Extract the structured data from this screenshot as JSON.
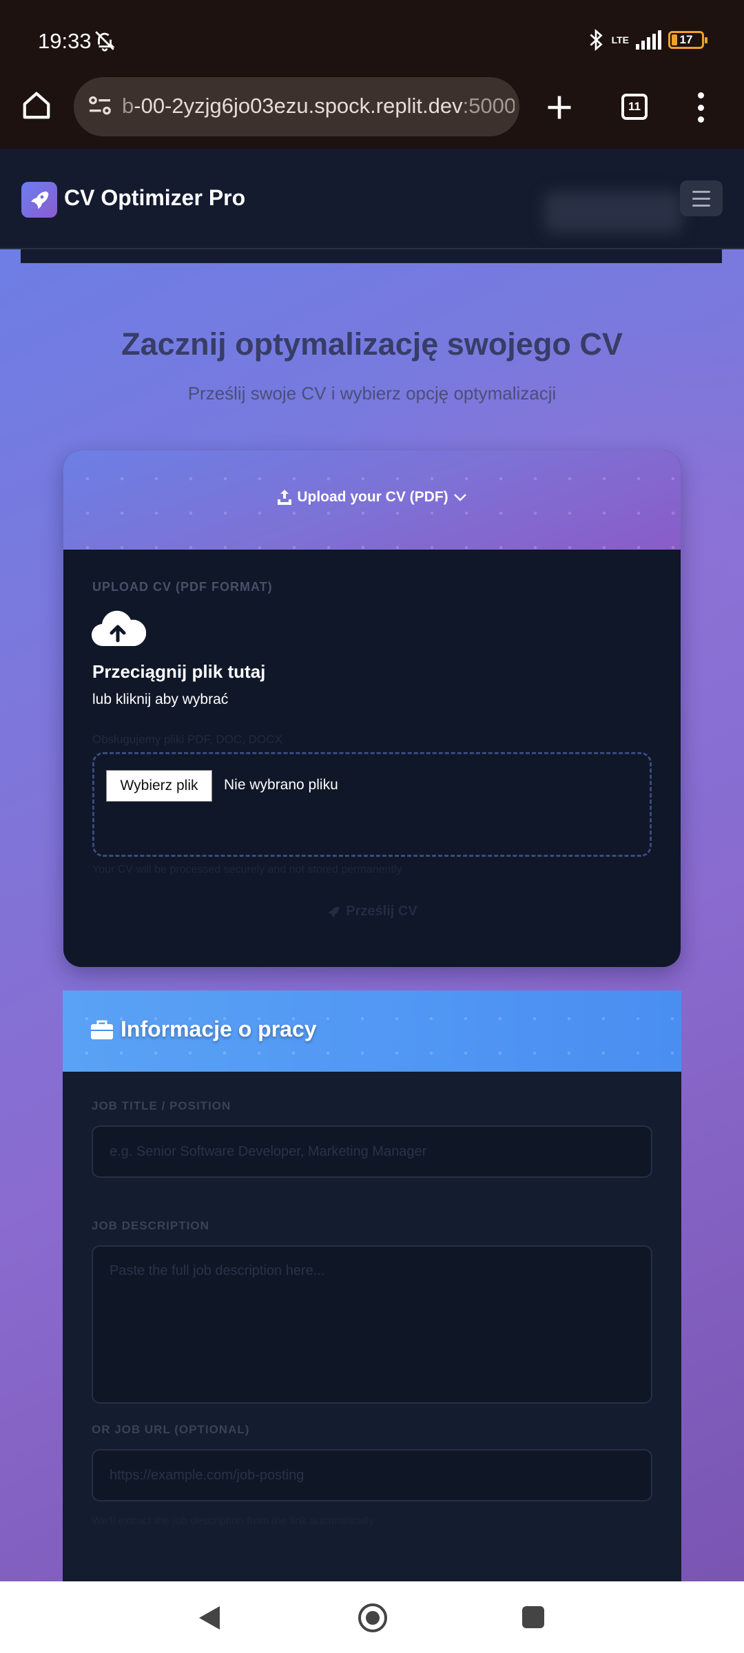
{
  "status_bar": {
    "time": "19:33",
    "network": "LTE",
    "battery": "17"
  },
  "browser": {
    "url_prefix": "b",
    "url_main": "-00-2yzjg6jo03ezu.spock.replit.dev",
    "url_port": ":5000",
    "tab_count": "11"
  },
  "site": {
    "title": "CV Optimizer Pro"
  },
  "hero": {
    "heading": "Zacznij optymalizację swojego CV",
    "subheading": "Prześlij swoje CV i wybierz opcję optymalizacji"
  },
  "upload_card": {
    "header_label": "Upload your CV (PDF)",
    "field_label": "UPLOAD CV (PDF FORMAT)",
    "drag_title": "Przeciągnij plik tutaj",
    "drag_subtitle": "lub kliknij aby wybrać",
    "supported": "Obsługujemy pliki PDF, DOC, DOCX",
    "choose_button": "Wybierz plik",
    "no_file": "Nie wybrano pliku",
    "secure_note": "Your CV will be processed securely and not stored permanently",
    "submit_label": "Prześlij CV"
  },
  "job_card": {
    "header_label": "Informacje o pracy",
    "title_label": "JOB TITLE / POSITION",
    "title_placeholder": "e.g. Senior Software Developer, Marketing Manager",
    "description_label": "JOB DESCRIPTION",
    "description_placeholder": "Paste the full job description here...",
    "url_label": "OR JOB URL (OPTIONAL)",
    "url_placeholder": "https://example.com/job-posting",
    "url_hint": "We'll extract the job description from the link automatically"
  },
  "colors": {
    "header_bg": "#141b2e",
    "upload_gradient_start": "#6c7fe4",
    "upload_gradient_end": "#8a5cc8",
    "job_header": "#4a8ef2",
    "card_bg": "#0f1728"
  }
}
